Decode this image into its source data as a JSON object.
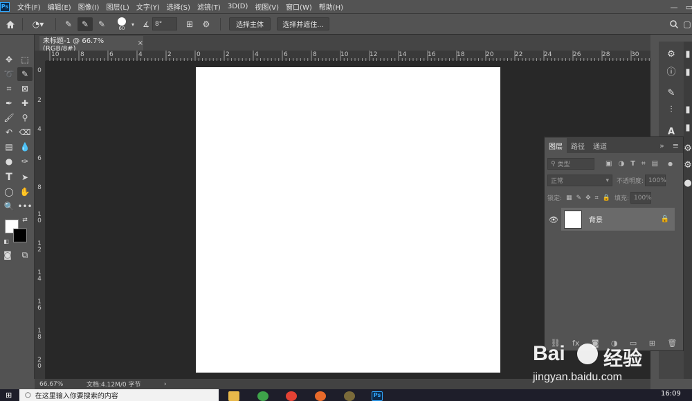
{
  "app": {
    "logo_text": "Ps",
    "menus": [
      "文件(F)",
      "编辑(E)",
      "图像(I)",
      "图层(L)",
      "文字(Y)",
      "选择(S)",
      "滤镜(T)",
      "3D(D)",
      "视图(V)",
      "窗口(W)",
      "帮助(H)"
    ],
    "window_controls": [
      "—",
      "▭"
    ]
  },
  "options": {
    "brush_size": "60",
    "angle": "8°",
    "select_subject": "选择主体",
    "select_and_mask": "选择并遮住..."
  },
  "document": {
    "tab_title": "未标题-1 @ 66.7%(RGB/8#)",
    "tab_close": "×",
    "zoom": "66.67%",
    "doc_info": "文档:4.12M/0 字节",
    "status_arrow": "›"
  },
  "rulers": {
    "top": [
      "10",
      "8",
      "6",
      "4",
      "2",
      "0",
      "2",
      "4",
      "6",
      "8",
      "10",
      "12",
      "14",
      "16",
      "18",
      "20",
      "22",
      "24",
      "26",
      "28",
      "30"
    ],
    "left": [
      "0",
      "2",
      "4",
      "6",
      "8",
      "10",
      "12",
      "14",
      "16",
      "18",
      "20"
    ]
  },
  "layers_panel": {
    "tabs": [
      "图层",
      "路径",
      "通道"
    ],
    "search_placeholder": "类型",
    "blend_mode": "正常",
    "opacity_label": "不透明度:",
    "opacity_value": "100%",
    "lock_label": "锁定:",
    "fill_label": "填充:",
    "fill_value": "100%",
    "layers": [
      {
        "name": "背景",
        "visible": true,
        "locked": true
      }
    ],
    "menu_icon": "≡",
    "collapse_icon": "»"
  },
  "taskbar": {
    "search_placeholder": "在这里输入你要搜索的内容",
    "clock": "16:09"
  },
  "watermark": {
    "brand": "Bai",
    "brand2": "经验",
    "url": "jingyan.baidu.com"
  },
  "colors": {
    "bg_panel": "#535353",
    "canvas_bg": "#282828",
    "canvas": "#ffffff",
    "ps_blue": "#31a8ff"
  }
}
